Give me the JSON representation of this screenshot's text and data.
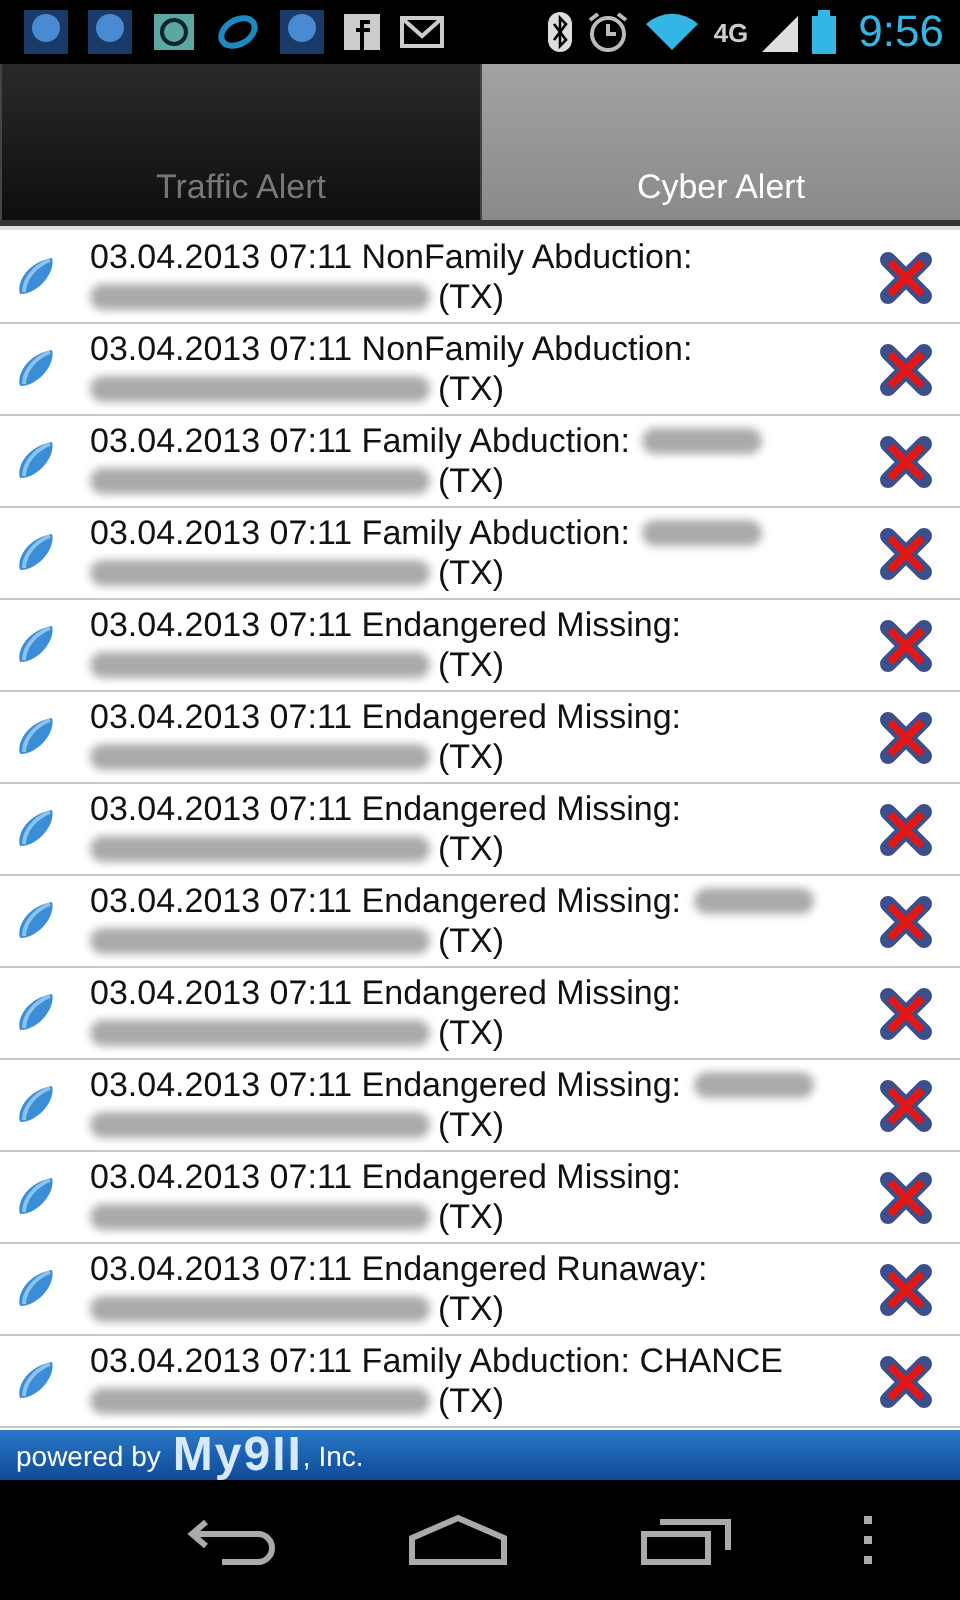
{
  "status_bar": {
    "time": "9:56",
    "network": "4G"
  },
  "tabs": [
    {
      "label": "Traffic Alert",
      "selected": false
    },
    {
      "label": "Cyber Alert",
      "selected": true
    }
  ],
  "alerts": [
    {
      "text": "03.04.2013 07:11 NonFamily Abduction:",
      "name_redacted": false,
      "region": "(TX)"
    },
    {
      "text": "03.04.2013 07:11 NonFamily Abduction:",
      "name_redacted": false,
      "region": "(TX)"
    },
    {
      "text": "03.04.2013 07:11 Family Abduction:",
      "name_redacted": true,
      "region": "(TX)"
    },
    {
      "text": "03.04.2013 07:11 Family Abduction:",
      "name_redacted": true,
      "region": "(TX)"
    },
    {
      "text": "03.04.2013 07:11 Endangered Missing:",
      "name_redacted": false,
      "region": "(TX)"
    },
    {
      "text": "03.04.2013 07:11 Endangered Missing:",
      "name_redacted": false,
      "region": "(TX)"
    },
    {
      "text": "03.04.2013 07:11 Endangered Missing:",
      "name_redacted": false,
      "region": "(TX)"
    },
    {
      "text": "03.04.2013 07:11 Endangered Missing:",
      "name_redacted": true,
      "region": "(TX)"
    },
    {
      "text": "03.04.2013 07:11 Endangered Missing:",
      "name_redacted": false,
      "region": "(TX)"
    },
    {
      "text": "03.04.2013 07:11 Endangered Missing:",
      "name_redacted": true,
      "region": "(TX)"
    },
    {
      "text": "03.04.2013 07:11 Endangered Missing:",
      "name_redacted": false,
      "region": "(TX)"
    },
    {
      "text": "03.04.2013 07:11 Endangered Runaway:",
      "name_redacted": false,
      "region": "(TX)"
    },
    {
      "text": "03.04.2013 07:11 Family Abduction: CHANCE",
      "name_redacted": false,
      "region": "(TX)"
    }
  ],
  "footer": {
    "prefix": "powered by",
    "brand": "My9II",
    "suffix": ", Inc."
  }
}
